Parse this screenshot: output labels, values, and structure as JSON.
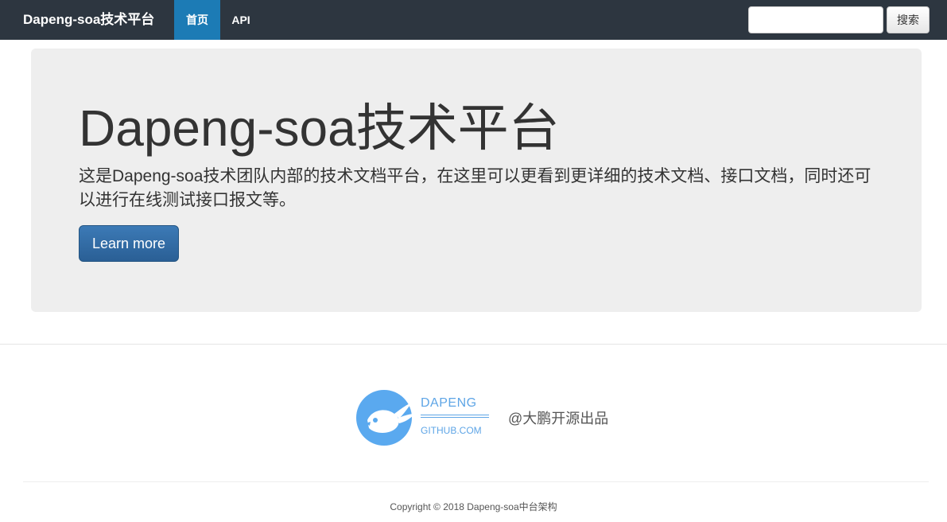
{
  "navbar": {
    "brand": "Dapeng-soa技术平台",
    "items": [
      {
        "label": "首页",
        "active": true
      },
      {
        "label": "API",
        "active": false
      }
    ],
    "search": {
      "value": "",
      "placeholder": "",
      "button_label": "搜索"
    }
  },
  "jumbotron": {
    "title": "Dapeng-soa技术平台",
    "description": "这是Dapeng-soa技术团队内部的技术文档平台，在这里可以更看到更详细的技术文档、接口文档，同时还可以进行在线测试接口报文等。",
    "button_label": "Learn more"
  },
  "footer": {
    "logo": {
      "top_text": "DAPENG",
      "bottom_text": "GITHUB.COM",
      "icon": "bird-logo-icon"
    },
    "author": "@大鹏开源出品",
    "copyright": "Copyright © 2018 Dapeng-soa中台架构"
  },
  "colors": {
    "navbar_bg": "#2d3640",
    "nav_active": "#1c7bb5",
    "jumbotron_bg": "#eeeeee",
    "primary_button": "#2a5f95",
    "logo_blue": "#5ea5e6"
  }
}
